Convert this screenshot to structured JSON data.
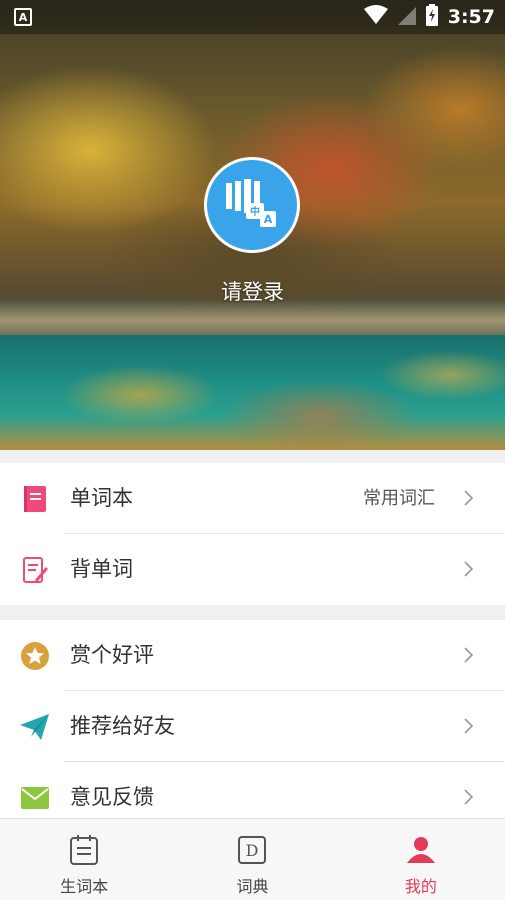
{
  "status_bar": {
    "time": "3:57",
    "left_icon": "A",
    "icons": [
      "wifi-icon",
      "signal-icon",
      "battery-charging-icon"
    ]
  },
  "profile": {
    "login_prompt": "请登录",
    "avatar_icon": "translate-app-icon",
    "avatar_color": "#39a4e9"
  },
  "menu_group_1": [
    {
      "label": "单词本",
      "value": "常用词汇",
      "icon": "wordbook-icon",
      "icon_color": "#ef4a79"
    },
    {
      "label": "背单词",
      "value": "",
      "icon": "memorize-icon",
      "icon_color": "#ef4a79"
    }
  ],
  "menu_group_2": [
    {
      "label": "赏个好评",
      "value": "",
      "icon": "star-icon",
      "icon_color": "#d8a13d"
    },
    {
      "label": "推荐给好友",
      "value": "",
      "icon": "send-icon",
      "icon_color": "#22a7b0"
    },
    {
      "label": "意见反馈",
      "value": "",
      "icon": "mail-icon",
      "icon_color": "#8dc63f"
    }
  ],
  "bottom_nav": [
    {
      "label": "生词本",
      "icon": "notebook-icon",
      "active": false
    },
    {
      "label": "词典",
      "icon": "dictionary-icon",
      "active": false
    },
    {
      "label": "我的",
      "icon": "user-icon",
      "active": true
    }
  ],
  "colors": {
    "accent": "#e23c5a",
    "separator": "#e6e6e6"
  }
}
